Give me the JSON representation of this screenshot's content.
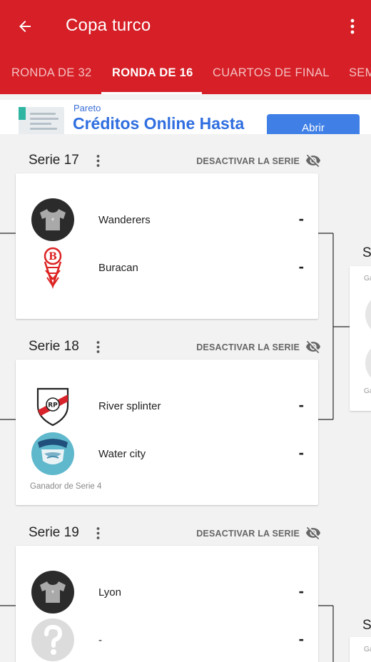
{
  "app": {
    "title": "Copa turco"
  },
  "tabs": [
    {
      "label": "RONDA DE 32"
    },
    {
      "label": "RONDA DE 16"
    },
    {
      "label": "CUARTOS DE FINAL"
    },
    {
      "label": "SEM"
    }
  ],
  "ad": {
    "brand": "Pareto",
    "headline": "Créditos Online Hasta",
    "cta": "Abrir"
  },
  "series": [
    {
      "name": "Serie 17",
      "toggle_label": "DESACTIVAR LA SERIE",
      "teams": [
        {
          "name": "Wanderers",
          "score": "-",
          "logo": "jersey-icon"
        },
        {
          "name": "Buracan",
          "score": "-",
          "logo": "huracan-crest-icon"
        }
      ],
      "winner_note": ""
    },
    {
      "name": "Serie 18",
      "toggle_label": "DESACTIVAR LA SERIE",
      "teams": [
        {
          "name": "River splinter",
          "score": "-",
          "logo": "river-crest-icon"
        },
        {
          "name": "Water city",
          "score": "-",
          "logo": "water-city-crest-icon"
        }
      ],
      "winner_note": "Ganador de Serie 4"
    },
    {
      "name": "Serie 19",
      "toggle_label": "DESACTIVAR LA SERIE",
      "teams": [
        {
          "name": "Lyon",
          "score": "-",
          "logo": "jersey-icon"
        },
        {
          "name": "-",
          "score": "-",
          "logo": "unknown-team-icon"
        }
      ],
      "winner_note": ""
    }
  ],
  "next_round_peek": [
    {
      "name": "S",
      "note_top": "Ga",
      "note_bottom": "Ga"
    },
    {
      "name": "S",
      "note_top": "Ga"
    }
  ],
  "colors": {
    "primary": "#d61f26",
    "ad_blue": "#2f6ee0",
    "cta_blue": "#3f7fe6"
  }
}
